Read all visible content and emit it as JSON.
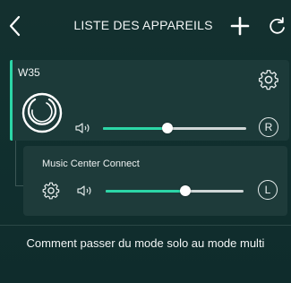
{
  "header": {
    "title": "LISTE DES APPAREILS",
    "back_icon": "chevron-left-icon",
    "add_icon": "plus-icon",
    "refresh_icon": "refresh-icon"
  },
  "devices": [
    {
      "name": "W35",
      "volume": 0.45,
      "channel": "R",
      "power_icon": "power-icon",
      "settings_icon": "gear-icon",
      "speaker_icon": "speaker-icon"
    },
    {
      "name": "Music Center Connect",
      "volume": 0.58,
      "channel": "L",
      "settings_icon": "gear-icon",
      "speaker_icon": "speaker-icon"
    }
  ],
  "help_link": "Comment passer du mode solo au mode multi",
  "colors": {
    "accent": "#2cd6a7",
    "background": "#0f2b2c",
    "card": "#1c3a39"
  }
}
